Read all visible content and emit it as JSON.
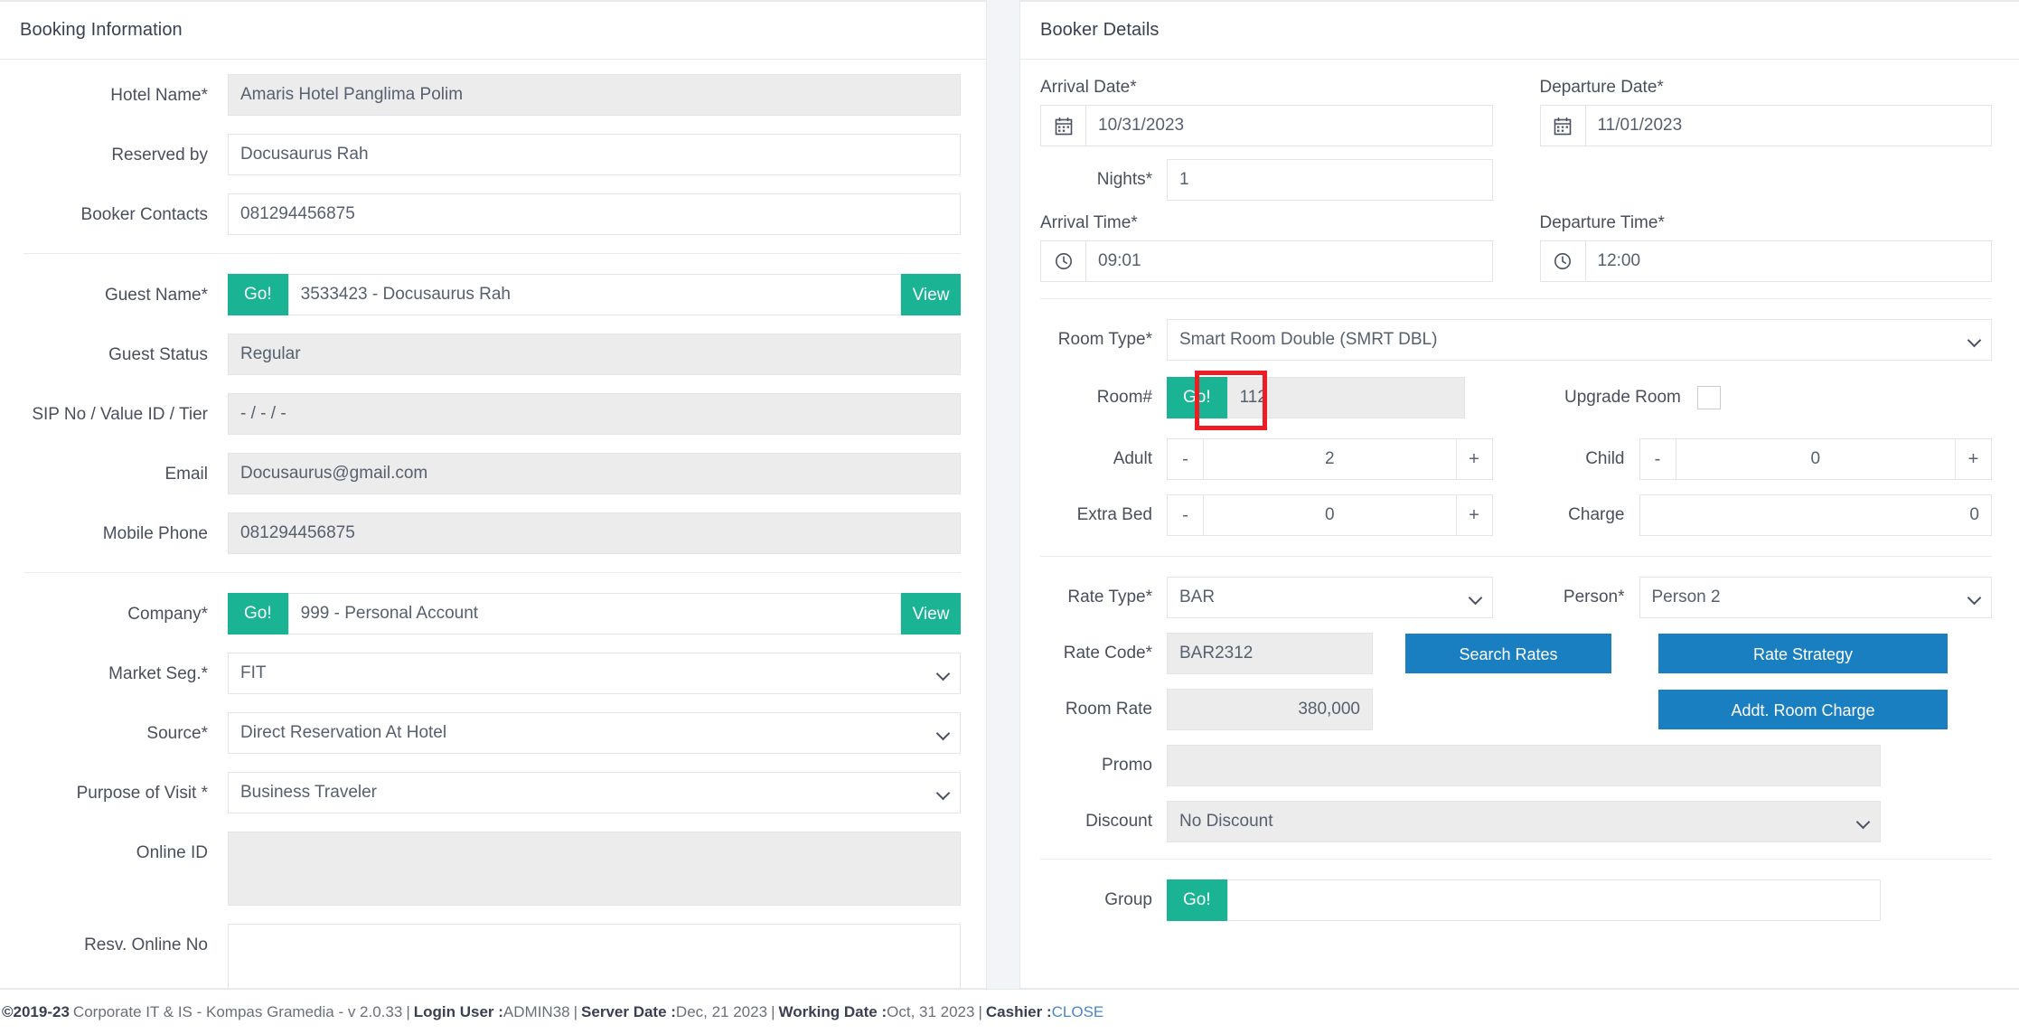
{
  "booking_panel": {
    "title": "Booking Information",
    "fields": {
      "hotel_name_label": "Hotel Name*",
      "hotel_name_value": "Amaris Hotel Panglima Polim",
      "reserved_by_label": "Reserved by",
      "reserved_by_value": "Docusaurus Rah",
      "booker_contacts_label": "Booker Contacts",
      "booker_contacts_value": "081294456875",
      "guest_name_label": "Guest Name*",
      "guest_name_value": "3533423 - Docusaurus Rah",
      "guest_name_go": "Go!",
      "guest_name_view": "View",
      "guest_status_label": "Guest Status",
      "guest_status_value": "Regular",
      "sip_label": "SIP No / Value ID / Tier",
      "sip_value": "-  /  -  /  -",
      "email_label": "Email",
      "email_value": "Docusaurus@gmail.com",
      "mobile_phone_label": "Mobile Phone",
      "mobile_phone_value": "081294456875",
      "company_label": "Company*",
      "company_value": "999 - Personal Account",
      "company_go": "Go!",
      "company_view": "View",
      "market_seg_label": "Market Seg.*",
      "market_seg_value": "FIT",
      "source_label": "Source*",
      "source_value": "Direct Reservation At Hotel",
      "purpose_label": "Purpose of Visit *",
      "purpose_value": "Business Traveler",
      "online_id_label": "Online ID",
      "online_id_value": "",
      "resv_online_no_label": "Resv. Online No",
      "resv_online_no_value": ""
    }
  },
  "booker_panel": {
    "title": "Booker Details",
    "arrival_date_label": "Arrival Date*",
    "arrival_date_value": "10/31/2023",
    "departure_date_label": "Departure Date*",
    "departure_date_value": "11/01/2023",
    "nights_label": "Nights*",
    "nights_value": "1",
    "arrival_time_label": "Arrival Time*",
    "arrival_time_value": "09:01",
    "departure_time_label": "Departure Time*",
    "departure_time_value": "12:00",
    "room_type_label": "Room Type*",
    "room_type_value": "Smart Room Double (SMRT DBL)",
    "room_number_label": "Room#",
    "room_number_go": "Go!",
    "room_number_value": "112",
    "upgrade_room_label": "Upgrade Room",
    "upgrade_room_checked": false,
    "adult_label": "Adult",
    "adult_value": "2",
    "child_label": "Child",
    "child_value": "0",
    "extra_bed_label": "Extra Bed",
    "extra_bed_value": "0",
    "charge_label": "Charge",
    "charge_value": "0",
    "stepper_minus": "-",
    "stepper_plus": "+",
    "rate_type_label": "Rate Type*",
    "rate_type_value": "BAR",
    "person_label": "Person*",
    "person_value": "Person 2",
    "rate_code_label": "Rate Code*",
    "rate_code_value": "BAR2312",
    "search_rates_button": "Search Rates",
    "rate_strategy_button": "Rate Strategy",
    "room_rate_label": "Room Rate",
    "room_rate_value": "380,000",
    "addt_room_charge_button": "Addt. Room Charge",
    "promo_label": "Promo",
    "promo_value": "",
    "discount_label": "Discount",
    "discount_value": "No Discount",
    "group_label": "Group",
    "group_go": "Go!",
    "group_value": ""
  },
  "icons": {
    "calendar": "calendar-icon",
    "clock": "clock-icon",
    "chevron_down": "chevron-down-icon"
  },
  "footer": {
    "copyright": "©2019-23",
    "company": "Corporate IT & IS - Kompas Gramedia - v 2.0.33",
    "sep1": "|",
    "login_user_label": "Login User :",
    "login_user_value": "ADMIN38",
    "sep2": "|",
    "server_date_label": "Server Date :",
    "server_date_value": "Dec, 21 2023",
    "sep3": "|",
    "working_date_label": "Working Date :",
    "working_date_value": "Oct, 31 2023",
    "sep4": "|",
    "cashier_label": "Cashier :",
    "cashier_value": "CLOSE"
  },
  "colors": {
    "green_accent": "#1ab394",
    "blue_button": "#1a7fc1",
    "highlight_red": "#ee1c25",
    "page_bg": "#f3f4f7"
  }
}
